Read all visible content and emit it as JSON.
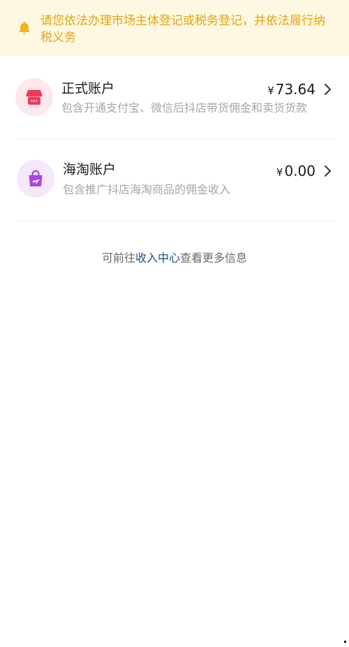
{
  "notice": {
    "text": "请您依法办理市场主体登记或税务登记，并依法履行纳税义务",
    "icon": "bell-icon",
    "color": "#e2a610",
    "background": "#fef7e1"
  },
  "accounts": [
    {
      "title": "正式账户",
      "description": "包含开通支付宝、微信后抖店带货佣金和卖货货款",
      "currency": "¥",
      "amount": "73.64",
      "icon": "shop-icon",
      "accent": "#f0385c"
    },
    {
      "title": "海淘账户",
      "description": "包含推广抖店海淘商品的佣金收入",
      "currency": "¥",
      "amount": "0.00",
      "icon": "shopping-bag-plane-icon",
      "accent": "#a745e8"
    }
  ],
  "footer": {
    "prefix": "可前往",
    "link": "收入中心",
    "suffix": "查看更多信息"
  }
}
